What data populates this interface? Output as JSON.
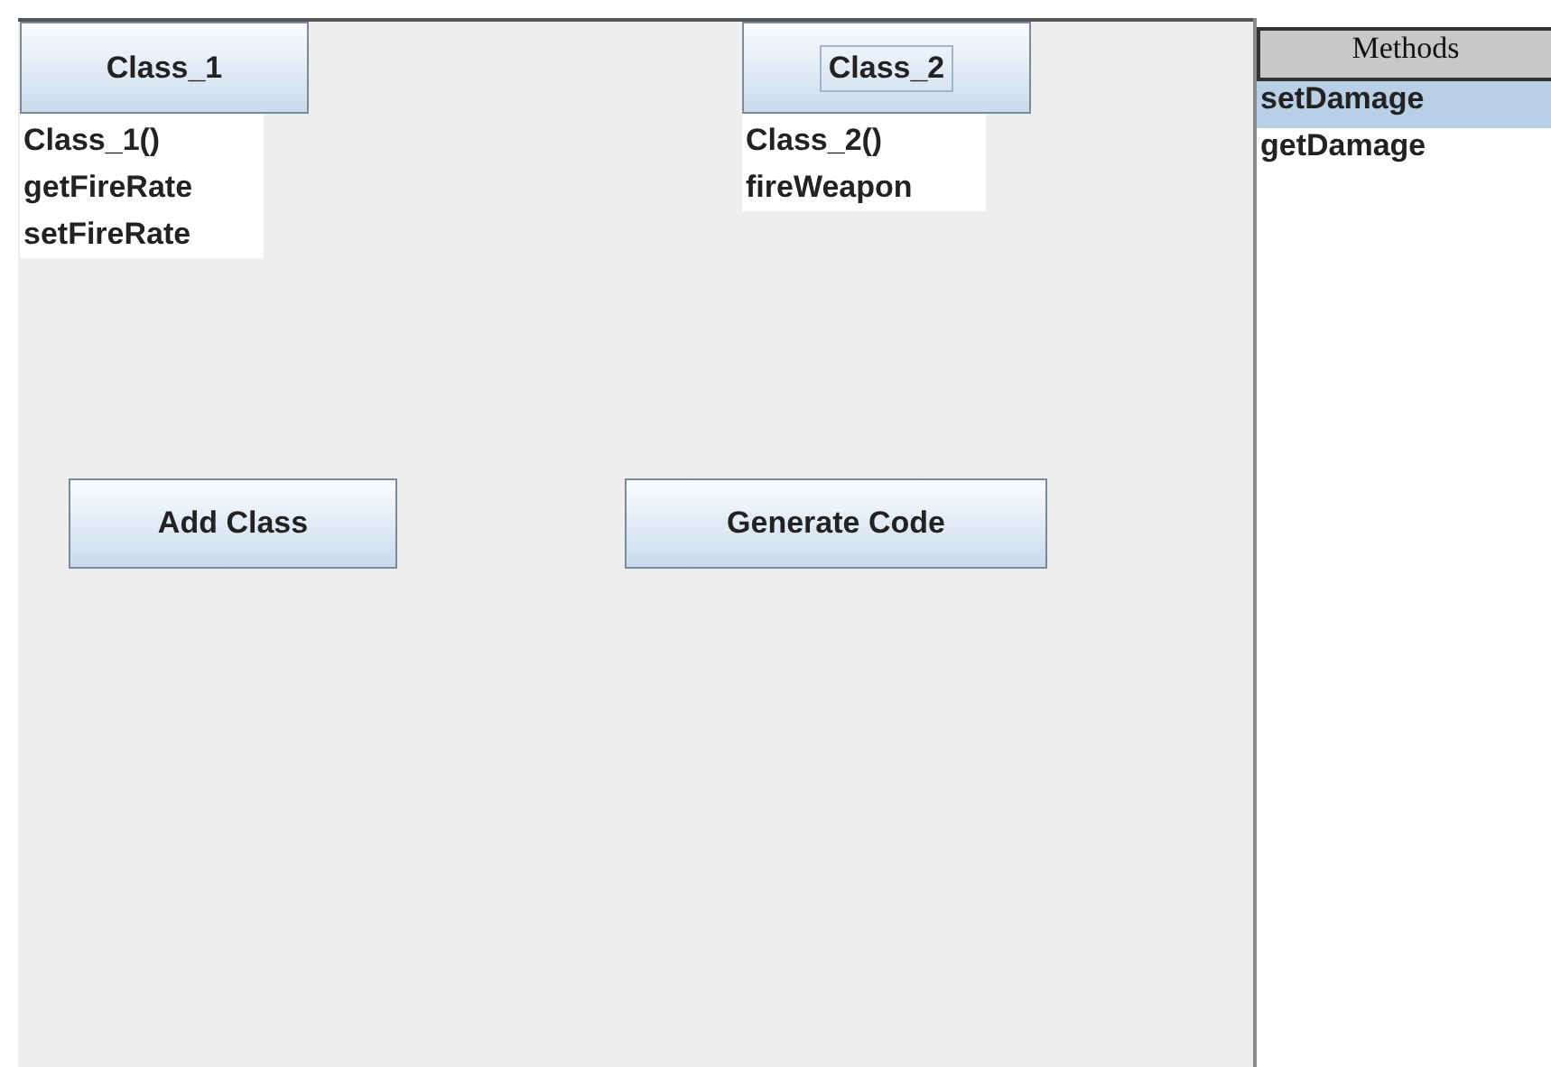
{
  "classes": [
    {
      "name": "Class_1",
      "focused": false,
      "methods": [
        "Class_1()",
        "getFireRate",
        "setFireRate"
      ]
    },
    {
      "name": "Class_2",
      "focused": true,
      "methods": [
        "Class_2()",
        "fireWeapon"
      ]
    }
  ],
  "buttons": [
    "Add Class",
    "Generate Code"
  ],
  "methods_panel": {
    "header": "Methods",
    "items": [
      {
        "label": "setDamage",
        "selected": true
      },
      {
        "label": "getDamage",
        "selected": false
      }
    ]
  }
}
